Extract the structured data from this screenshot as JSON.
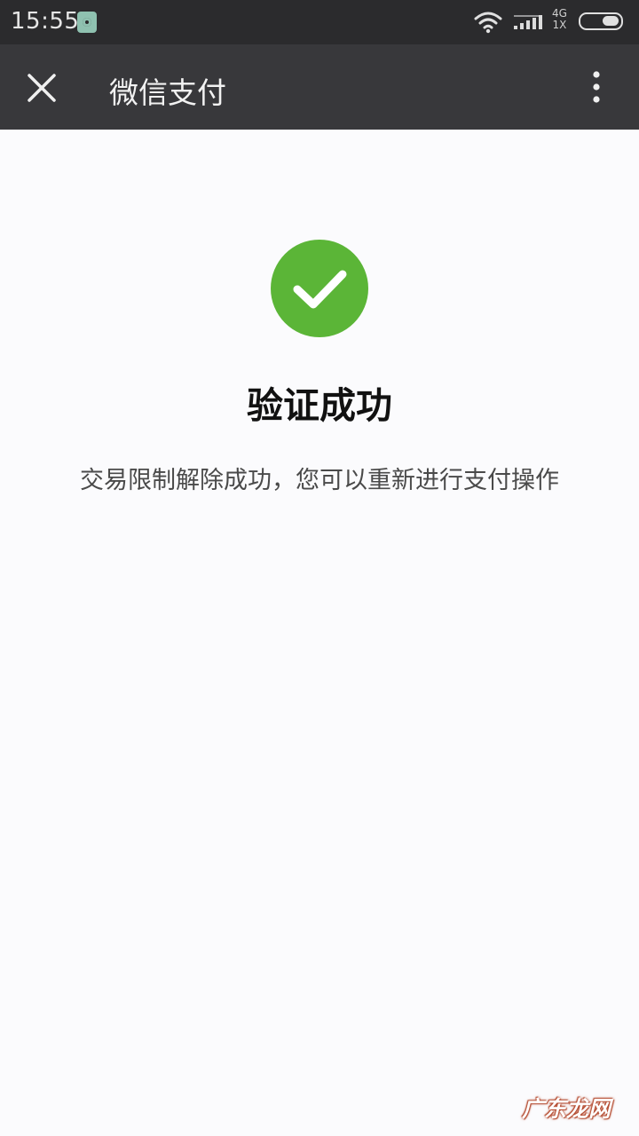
{
  "status_bar": {
    "time": "15:55",
    "network_type_top": "4G",
    "network_type_bottom": "1X",
    "icons": [
      "notification-app-icon",
      "wifi-icon",
      "signal-icon",
      "battery-icon"
    ]
  },
  "title_bar": {
    "title": "微信支付",
    "close_icon": "close-icon",
    "more_icon": "more-vertical-icon"
  },
  "result": {
    "icon": "success-check-icon",
    "title": "验证成功",
    "description": "交易限制解除成功，您可以重新进行支付操作"
  },
  "watermark": "广东龙网",
  "colors": {
    "status_bar_bg": "#2b2b2d",
    "title_bar_bg": "#38383b",
    "success_green": "#5bb537",
    "page_bg": "#fbfbfd"
  }
}
